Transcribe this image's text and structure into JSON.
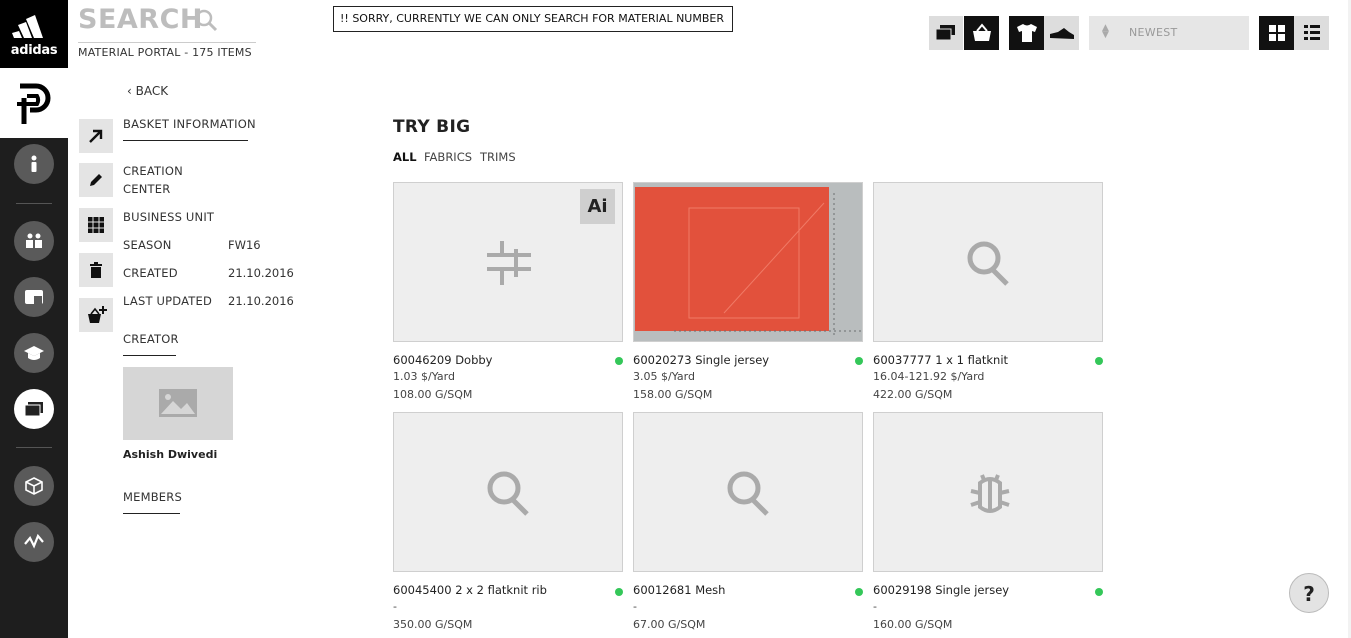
{
  "brand": {
    "wordmark": "adidas"
  },
  "header": {
    "search_label": "SEARCH",
    "portal_subtitle": "MATERIAL PORTAL - 175 ITEMS",
    "notice": "!! SORRY, CURRENTLY WE CAN ONLY SEARCH FOR MATERIAL NUMBER",
    "sort_value": "NEWEST"
  },
  "panel": {
    "back_label": "BACK",
    "basket_information": "BASKET INFORMATION",
    "creation_center_line1": "CREATION",
    "creation_center_line2": "CENTER",
    "business_unit": "BUSINESS UNIT",
    "season_label": "SEASON",
    "season_value": "FW16",
    "created_label": "CREATED",
    "created_value": "21.10.2016",
    "updated_label": "LAST UPDATED",
    "updated_value": "21.10.2016",
    "creator_label": "CREATOR",
    "creator_name": "Ashish Dwivedi",
    "members_label": "MEMBERS"
  },
  "main": {
    "title": "TRY BIG",
    "filters": [
      "ALL",
      "FABRICS",
      "TRIMS"
    ]
  },
  "materials": [
    {
      "name": "60046209 Dobby",
      "price": "1.03 $/Yard",
      "weight": "108.00 G/SQM",
      "icon": "trim-icon",
      "badge": "Ai"
    },
    {
      "name": "60020273 Single jersey",
      "price": "3.05 $/Yard",
      "weight": "158.00 G/SQM",
      "icon": "fabric-swatch-photo"
    },
    {
      "name": "60037777 1 x 1 flatknit",
      "price": "16.04-121.92 $/Yard",
      "weight": "422.00 G/SQM",
      "icon": "search-placeholder-icon"
    },
    {
      "name": "60045400 2 x 2 flatknit rib",
      "price": "-",
      "weight": "350.00 G/SQM",
      "icon": "search-placeholder-icon"
    },
    {
      "name": "60012681 Mesh",
      "price": "-",
      "weight": "67.00 G/SQM",
      "icon": "search-placeholder-icon"
    },
    {
      "name": "60029198 Single jersey",
      "price": "-",
      "weight": "160.00 G/SQM",
      "icon": "bug-icon"
    }
  ],
  "help_label": "?",
  "colors": {
    "rail": "#1e1e1e",
    "status_available": "#34c759",
    "swatch": "#e2513c"
  }
}
